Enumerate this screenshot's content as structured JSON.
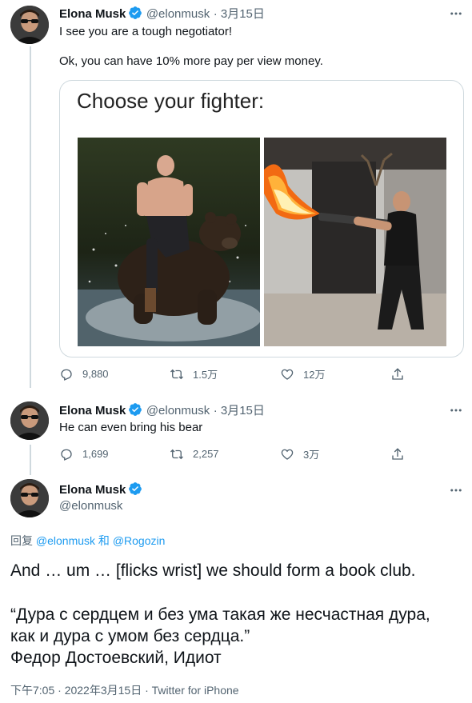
{
  "tweet1": {
    "name": "Elona Musk",
    "handle": "@elonmusk",
    "date": "· 3月15日",
    "line1": "I see you are a tough negotiator!",
    "line2": "Ok, you can have 10% more pay per view money.",
    "card_title": "Choose your fighter:",
    "replies": "9,880",
    "retweets": "1.5万",
    "likes": "12万"
  },
  "tweet2": {
    "name": "Elona Musk",
    "handle": "@elonmusk",
    "date": "· 3月15日",
    "text": "He can even bring his bear",
    "replies": "1,699",
    "retweets": "2,257",
    "likes": "3万"
  },
  "main": {
    "name": "Elona Musk",
    "handle": "@elonmusk",
    "reply_prefix": "回复",
    "reply_to_1": "@elonmusk",
    "reply_joiner": "和",
    "reply_to_2": "@Rogozin",
    "para1": "And … um … [flicks wrist] we should form a book club.",
    "quote_line1": "“Дура с сердцем и без ума такая же несчастная дура,",
    "quote_line2": "как и дура с умом без сердца.”",
    "quote_line3": "Федор Достоевский, Идиот",
    "timestamp": "下午7:05 · 2022年3月15日 · Twitter for iPhone"
  },
  "colors": {
    "accent": "#1d9bf0",
    "muted": "#536471",
    "line": "#cfd9de"
  }
}
